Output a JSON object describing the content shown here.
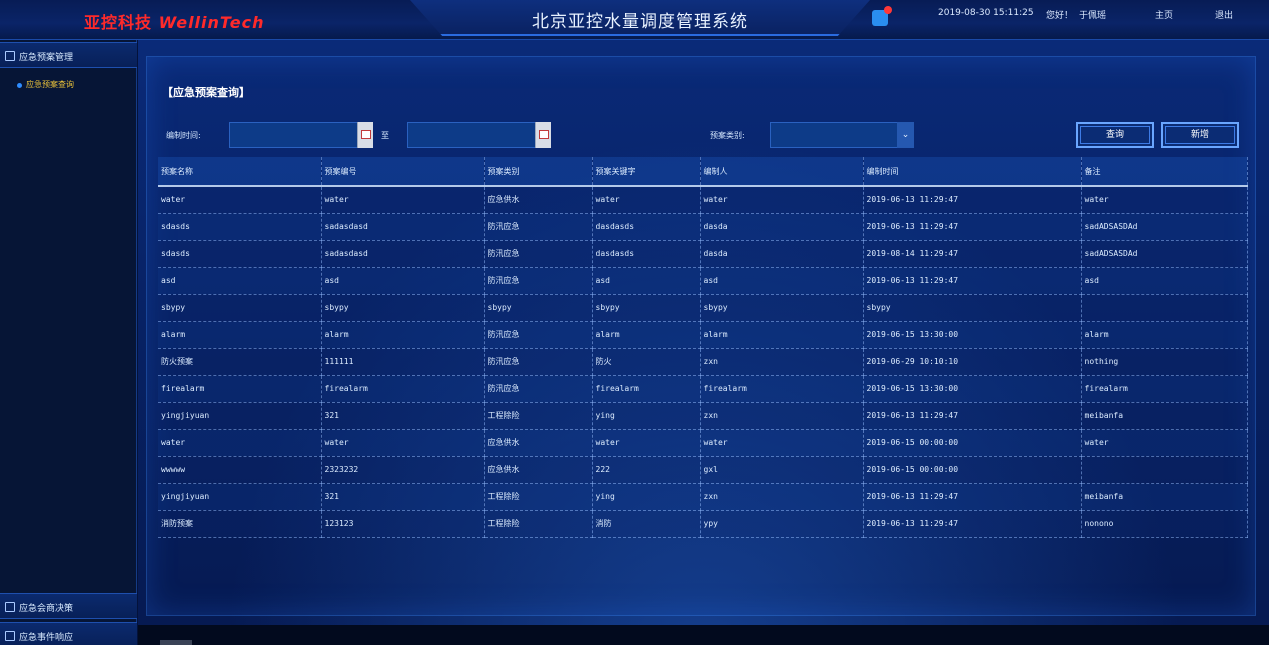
{
  "header": {
    "logo_cn": "亚控科技",
    "logo_en": "WellinTech",
    "system_title": "北京亚控水量调度管理系统",
    "datetime": "2019-08-30 15:11:25",
    "greeting": "您好！",
    "user": "于佩瑶",
    "home": "主页",
    "logout": "退出"
  },
  "sidebar": {
    "group1": "应急预案管理",
    "group1_sub": "应急预案查询",
    "group2": "应急会商决策",
    "group3": "应急事件响应"
  },
  "main": {
    "section_title": "【应急预案查询】",
    "date_label": "编制时间:",
    "to_label": "至",
    "type_label": "预案类别:",
    "query_btn": "查询",
    "add_btn": "新增"
  },
  "table": {
    "headers": [
      "预案名称",
      "预案编号",
      "预案类别",
      "预案关键字",
      "编制人",
      "编制时间",
      "备注"
    ],
    "rows": [
      [
        "water",
        "water",
        "应急供水",
        "water",
        "water",
        "2019-06-13 11:29:47",
        "water"
      ],
      [
        "sdasds",
        "sadasdasd",
        "防汛应急",
        "dasdasds",
        "dasda",
        "2019-06-13 11:29:47",
        "sadADSASDAd"
      ],
      [
        "sdasds",
        "sadasdasd",
        "防汛应急",
        "dasdasds",
        "dasda",
        "2019-08-14 11:29:47",
        "sadADSASDAd"
      ],
      [
        "asd",
        "asd",
        "防汛应急",
        "asd",
        "asd",
        "2019-06-13 11:29:47",
        "asd"
      ],
      [
        "sbypy",
        "sbypy",
        "sbypy",
        "sbypy",
        "sbypy",
        "sbypy",
        ""
      ],
      [
        "alarm",
        "alarm",
        "防汛应急",
        "alarm",
        "alarm",
        "2019-06-15 13:30:00",
        "alarm"
      ],
      [
        "防火预案",
        "111111",
        "防汛应急",
        "防火",
        "zxn",
        "2019-06-29 10:10:10",
        "nothing"
      ],
      [
        "firealarm",
        "firealarm",
        "防汛应急",
        "firealarm",
        "firealarm",
        "2019-06-15 13:30:00",
        "firealarm"
      ],
      [
        "yingjiyuan",
        "321",
        "工程除险",
        "ying",
        "zxn",
        "2019-06-13 11:29:47",
        "meibanfa"
      ],
      [
        "water",
        "water",
        "应急供水",
        "water",
        "water",
        "2019-06-15 00:00:00",
        "water"
      ],
      [
        "wwwww",
        "2323232",
        "应急供水",
        "222",
        "gxl",
        "2019-06-15 00:00:00",
        ""
      ],
      [
        "yingjiyuan",
        "321",
        "工程除险",
        "ying",
        "zxn",
        "2019-06-13 11:29:47",
        "meibanfa"
      ],
      [
        "消防预案",
        "123123",
        "工程除险",
        "消防",
        "ypy",
        "2019-06-13 11:29:47",
        "nonono"
      ]
    ]
  },
  "colors": {
    "accent": "#2e8cff",
    "logo": "#ff2a2a",
    "active_menu": "#e9c23a",
    "background": "#061a52"
  }
}
